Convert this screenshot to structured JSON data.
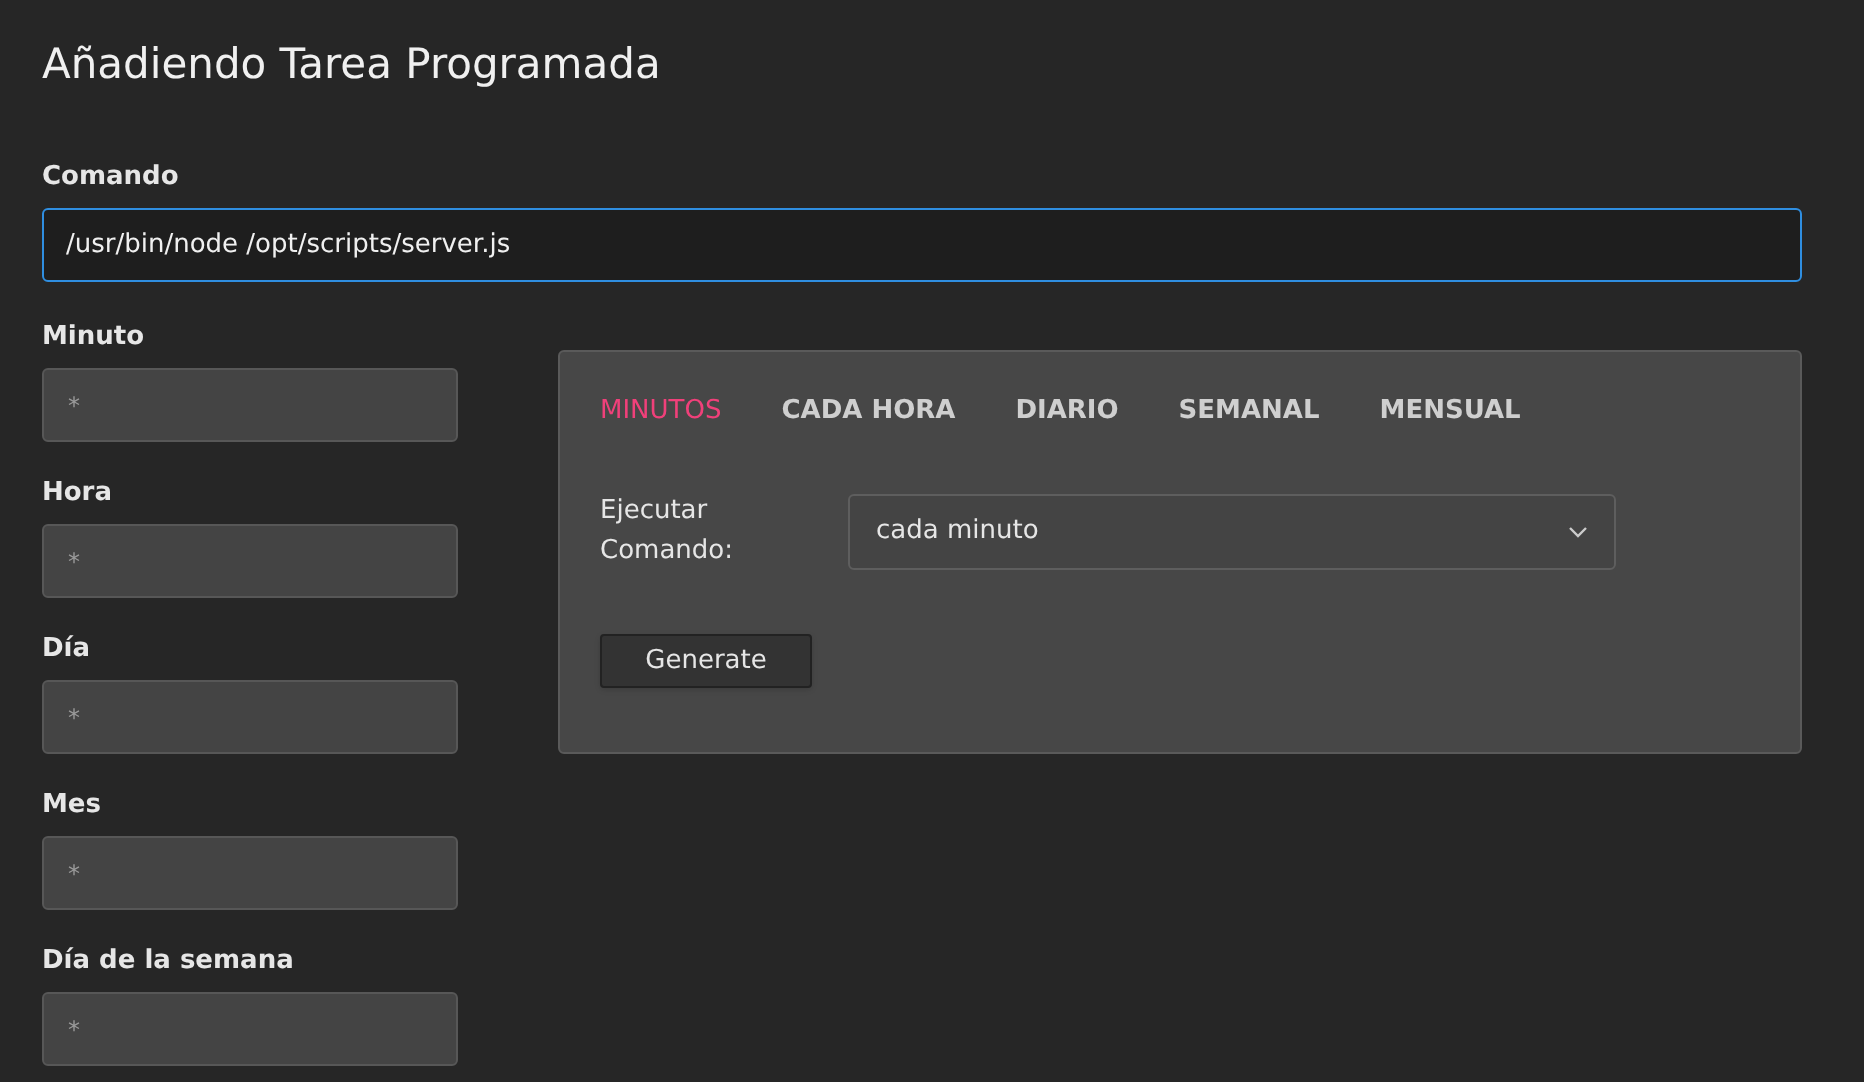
{
  "title": "Añadiendo Tarea Programada",
  "command": {
    "label": "Comando",
    "value": "/usr/bin/node /opt/scripts/server.js"
  },
  "fields": [
    {
      "label": "Minuto",
      "placeholder": "*"
    },
    {
      "label": "Hora",
      "placeholder": "*"
    },
    {
      "label": "Día",
      "placeholder": "*"
    },
    {
      "label": "Mes",
      "placeholder": "*"
    },
    {
      "label": "Día de la semana",
      "placeholder": "*"
    }
  ],
  "tabs": [
    {
      "label": "MINUTOS",
      "selected": true
    },
    {
      "label": "CADA HORA",
      "selected": false
    },
    {
      "label": "DIARIO",
      "selected": false
    },
    {
      "label": "SEMANAL",
      "selected": false
    },
    {
      "label": "MENSUAL",
      "selected": false
    }
  ],
  "execute": {
    "label": "Ejecutar Comando:",
    "value": "cada minuto"
  },
  "button": "Generate"
}
